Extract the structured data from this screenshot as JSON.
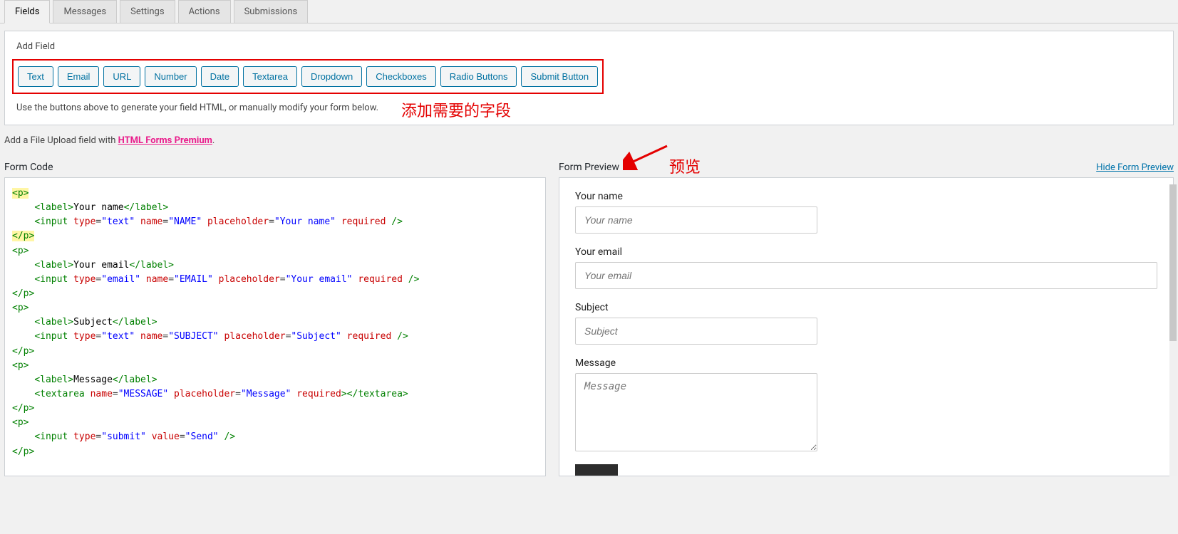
{
  "tabs": [
    "Fields",
    "Messages",
    "Settings",
    "Actions",
    "Submissions"
  ],
  "active_tab": "Fields",
  "add_field": {
    "label": "Add Field",
    "buttons": [
      "Text",
      "Email",
      "URL",
      "Number",
      "Date",
      "Textarea",
      "Dropdown",
      "Checkboxes",
      "Radio Buttons",
      "Submit Button"
    ],
    "help": "Use the buttons above to generate your field HTML, or manually modify your form below.",
    "annotation": "添加需要的字段"
  },
  "upload_line": {
    "prefix": "Add a File Upload field with ",
    "link": "HTML Forms Premium",
    "suffix": "."
  },
  "form_code": {
    "title": "Form Code",
    "lines": [
      {
        "hl": true,
        "html": "<span class='tag'>&lt;p&gt;</span>"
      },
      {
        "indent": 1,
        "html": "<span class='tag'>&lt;label&gt;</span><span class='txt'>Your name</span><span class='tag'>&lt;/label&gt;</span>"
      },
      {
        "indent": 1,
        "html": "<span class='tag'>&lt;input</span> <span class='attr'>type</span>=<span class='val'>\"text\"</span> <span class='attr'>name</span>=<span class='val'>\"NAME\"</span> <span class='attr'>placeholder</span>=<span class='val'>\"Your name\"</span> <span class='attr'>required</span> <span class='tag'>/&gt;</span>"
      },
      {
        "hl": true,
        "html": "<span class='tag'>&lt;/p&gt;</span>"
      },
      {
        "html": "<span class='tag'>&lt;p&gt;</span>"
      },
      {
        "indent": 1,
        "html": "<span class='tag'>&lt;label&gt;</span><span class='txt'>Your email</span><span class='tag'>&lt;/label&gt;</span>"
      },
      {
        "indent": 1,
        "html": "<span class='tag'>&lt;input</span> <span class='attr'>type</span>=<span class='val'>\"email\"</span> <span class='attr'>name</span>=<span class='val'>\"EMAIL\"</span> <span class='attr'>placeholder</span>=<span class='val'>\"Your email\"</span> <span class='attr'>required</span> <span class='tag'>/&gt;</span>"
      },
      {
        "html": "<span class='tag'>&lt;/p&gt;</span>"
      },
      {
        "html": "<span class='tag'>&lt;p&gt;</span>"
      },
      {
        "indent": 1,
        "html": "<span class='tag'>&lt;label&gt;</span><span class='txt'>Subject</span><span class='tag'>&lt;/label&gt;</span>"
      },
      {
        "indent": 1,
        "html": "<span class='tag'>&lt;input</span> <span class='attr'>type</span>=<span class='val'>\"text\"</span> <span class='attr'>name</span>=<span class='val'>\"SUBJECT\"</span> <span class='attr'>placeholder</span>=<span class='val'>\"Subject\"</span> <span class='attr'>required</span> <span class='tag'>/&gt;</span>"
      },
      {
        "html": "<span class='tag'>&lt;/p&gt;</span>"
      },
      {
        "html": "<span class='tag'>&lt;p&gt;</span>"
      },
      {
        "indent": 1,
        "html": "<span class='tag'>&lt;label&gt;</span><span class='txt'>Message</span><span class='tag'>&lt;/label&gt;</span>"
      },
      {
        "indent": 1,
        "html": "<span class='tag'>&lt;textarea</span> <span class='attr'>name</span>=<span class='val'>\"MESSAGE\"</span> <span class='attr'>placeholder</span>=<span class='val'>\"Message\"</span> <span class='attr'>required</span><span class='tag'>&gt;&lt;/textarea&gt;</span>"
      },
      {
        "html": "<span class='tag'>&lt;/p&gt;</span>"
      },
      {
        "html": "<span class='tag'>&lt;p&gt;</span>"
      },
      {
        "indent": 1,
        "html": "<span class='tag'>&lt;input</span> <span class='attr'>type</span>=<span class='val'>\"submit\"</span> <span class='attr'>value</span>=<span class='val'>\"Send\"</span> <span class='tag'>/&gt;</span>"
      },
      {
        "html": "<span class='tag'>&lt;/p&gt;</span>"
      }
    ]
  },
  "form_preview": {
    "title": "Form Preview",
    "hide_link": "Hide Form Preview",
    "annotation": "预览",
    "fields": [
      {
        "label": "Your name",
        "placeholder": "Your name",
        "type": "text",
        "wide": false
      },
      {
        "label": "Your email",
        "placeholder": "Your email",
        "type": "email",
        "wide": true
      },
      {
        "label": "Subject",
        "placeholder": "Subject",
        "type": "text",
        "wide": false
      },
      {
        "label": "Message",
        "placeholder": "Message",
        "type": "textarea",
        "wide": false
      }
    ]
  }
}
